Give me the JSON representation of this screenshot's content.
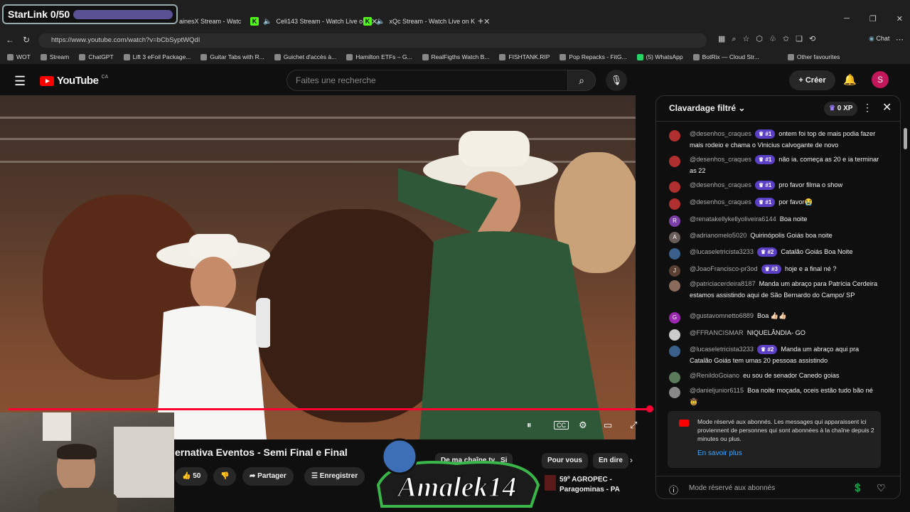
{
  "overlay": {
    "starlink": "StarLink 0/50"
  },
  "tabs": [
    {
      "label": "ainesX Stream - Watc",
      "kick": false
    },
    {
      "label": "Celi143 Stream - Watch Live o",
      "kick": true
    },
    {
      "label": "xQc Stream - Watch Live on K",
      "kick": true
    }
  ],
  "url": "https://www.youtube.com/watch?v=bCbSyptWQdI",
  "browser": {
    "chat_label": "Chat"
  },
  "bookmarks": [
    "WOT",
    "Stream",
    "ChatGPT",
    "Lift 3 eFoil Package...",
    "Guitar Tabs with R...",
    "Guichet d'accès à...",
    "Hamilton ETFs – G...",
    "RealFigths Watch B...",
    "FISHTANK.RIP",
    "Pop Repacks - FitG...",
    "(5) WhatsApp",
    "BotRix — Cloud Str...",
    "Other favourites"
  ],
  "yt": {
    "logo": "YouTube",
    "region": "CA",
    "search_placeholder": "Faites une recherche",
    "create": "Créer",
    "avatar_letter": "S"
  },
  "video": {
    "title": "ernativa Eventos - Semi Final e Final",
    "likes": "50",
    "share": "Partager",
    "save": "Enregistrer",
    "chips": [
      "De ma chaîne tv",
      "Si",
      "Pour vous",
      "En dire"
    ],
    "related_title": "59º AGROPEC - Paragominas - PA",
    "progress": 0.99
  },
  "chat": {
    "title": "Clavardage filtré",
    "xp": "0 XP",
    "messages": [
      {
        "avatar": "",
        "color": "#b03030",
        "author": "@desenhos_craques",
        "badge": "#1",
        "text": "ontem foi top de mais podia fazer mais rodeio e chama o Vinicius calvogante de novo"
      },
      {
        "avatar": "",
        "color": "#b03030",
        "author": "@desenhos_craques",
        "badge": "#1",
        "text": "não ia. começa as 20 e ia terminar as 22"
      },
      {
        "avatar": "",
        "color": "#b03030",
        "author": "@desenhos_craques",
        "badge": "#1",
        "text": "pro favor filma o show"
      },
      {
        "avatar": "",
        "color": "#b03030",
        "author": "@desenhos_craques",
        "badge": "#1",
        "text": "por favor😭"
      },
      {
        "avatar": "R",
        "color": "#7b3fa8",
        "author": "@renatakellykellyoliveira6144",
        "badge": "",
        "text": "Boa noite"
      },
      {
        "avatar": "A",
        "color": "#6b5e5a",
        "author": "@adrianomelo5020",
        "badge": "",
        "text": "Quirinópolis Goiás boa noite"
      },
      {
        "avatar": "",
        "color": "#3a5f8a",
        "author": "@lucaseletricista3233",
        "badge": "#2",
        "text": "Catalão Goiás Boa Noite"
      },
      {
        "avatar": "J",
        "color": "#5a4032",
        "author": "@JoaoFrancisco-pr3od",
        "badge": "#3",
        "text": "hoje e a final né ?"
      },
      {
        "avatar": "",
        "color": "#8a6a5a",
        "author": "@patriciacerdeira8187",
        "badge": "",
        "text": "Manda um abraço para Patrícia Cerdeira estamos assistindo aqui de São Bernardo do Campo/ SP"
      },
      {
        "avatar": "G",
        "color": "#9c27b0",
        "author": "@gustavomnetto6889",
        "badge": "",
        "text": "Boa 👍🏻👍🏻"
      },
      {
        "avatar": "",
        "color": "#cccccc",
        "author": "@FFRANCISMAR",
        "badge": "",
        "text": "NIQUELÂNDIA- GO"
      },
      {
        "avatar": "",
        "color": "#3a5f8a",
        "author": "@lucaseletricista3233",
        "badge": "#2",
        "text": "Manda um abraço aqui pra Catalão Goiás tem umas 20 pessoas assistindo"
      },
      {
        "avatar": "",
        "color": "#5a7a5a",
        "author": "@RenildoGoiano",
        "badge": "",
        "text": "eu sou de senador Canedo goias"
      },
      {
        "avatar": "",
        "color": "#888888",
        "author": "@danieljunior6115",
        "badge": "",
        "text": "Boa noite moçada, oceis estão tudo bão né 🤠"
      }
    ],
    "notice_text": "Mode réservé aux abonnés. Les messages qui apparaissent ici proviennent de personnes qui sont abonnées à la chaîne depuis 2 minutes ou plus.",
    "notice_link": "En savoir plus",
    "footer_label": "Mode réservé aux abonnés"
  },
  "colors": {
    "accent": "#ff0033",
    "badge": "#5b3fc4",
    "link": "#3ea6ff"
  }
}
